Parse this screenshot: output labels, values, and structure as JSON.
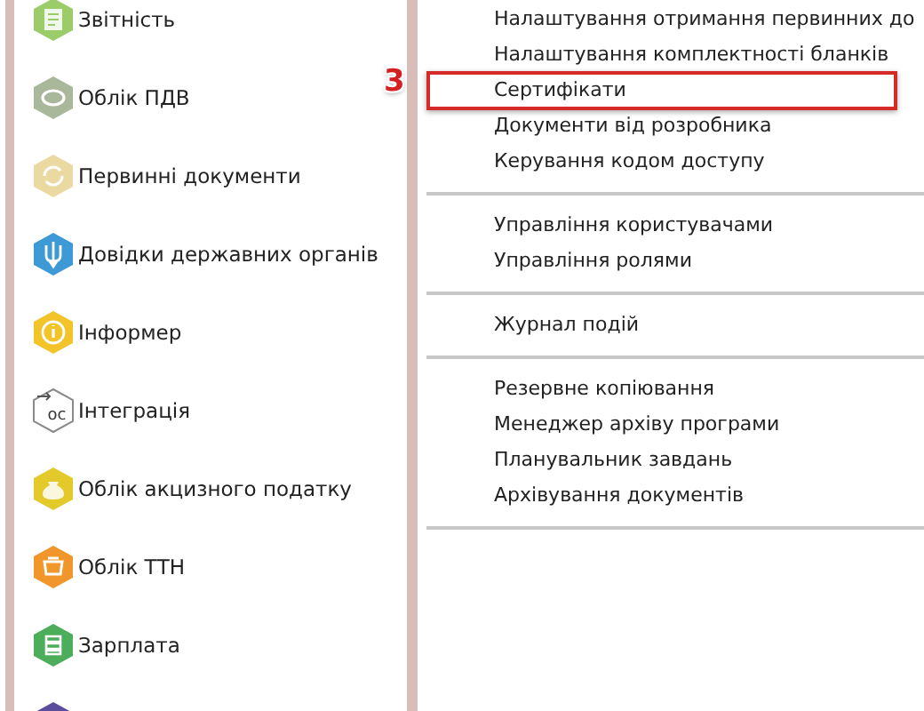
{
  "sidebar": {
    "items": [
      {
        "label": "Звітність",
        "kind": "report"
      },
      {
        "label": "Облік ПДВ",
        "kind": "vat"
      },
      {
        "label": "Первинні документи",
        "kind": "documents"
      },
      {
        "label": "Довідки державних органів",
        "kind": "trident"
      },
      {
        "label": "Інформер",
        "kind": "info"
      },
      {
        "label": "Інтеграція",
        "kind": "integration",
        "icon_text": "ос"
      },
      {
        "label": "Облік акцизного податку",
        "kind": "excise"
      },
      {
        "label": "Облік ТТН",
        "kind": "ttn"
      },
      {
        "label": "Зарплата",
        "kind": "salary"
      },
      {
        "kind": "purple"
      }
    ]
  },
  "menu": {
    "groups": [
      {
        "items": [
          {
            "label": "Налаштування отримання первинних до",
            "highlighted": false
          },
          {
            "label": "Налаштування комплектності бланків",
            "highlighted": false
          },
          {
            "label": "Сертифікати",
            "highlighted": true
          },
          {
            "label": "Документи від розробника",
            "highlighted": false
          },
          {
            "label": "Керування кодом доступу",
            "highlighted": false
          }
        ]
      },
      {
        "items": [
          {
            "label": "Управління користувачами",
            "highlighted": false
          },
          {
            "label": "Управління ролями",
            "highlighted": false
          }
        ]
      },
      {
        "items": [
          {
            "label": "Журнал подій",
            "highlighted": false
          }
        ]
      },
      {
        "items": [
          {
            "label": "Резервне копіювання",
            "highlighted": false
          },
          {
            "label": "Менеджер архіву програми",
            "highlighted": false
          },
          {
            "label": "Планувальник завдань",
            "highlighted": false
          },
          {
            "label": "Архівування документів",
            "highlighted": false
          }
        ]
      }
    ]
  },
  "callout": {
    "number": "3"
  }
}
